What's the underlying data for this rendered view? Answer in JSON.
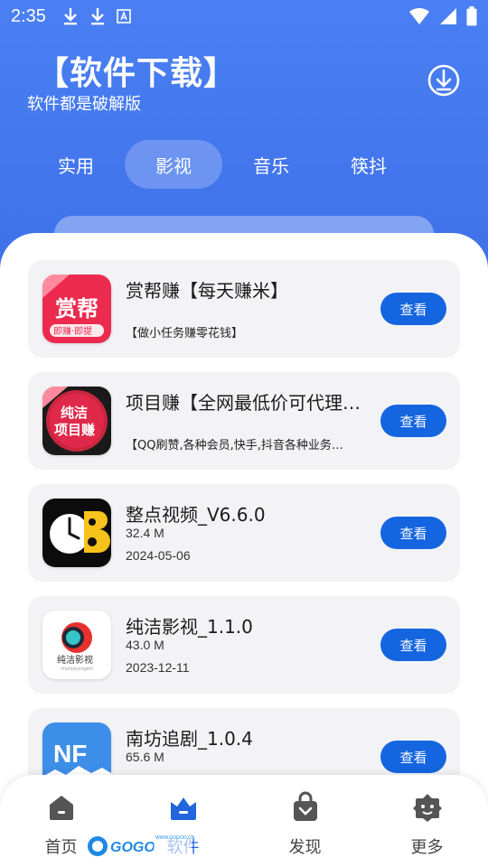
{
  "status_bar": {
    "time": "2:35",
    "left_icons": [
      "download-icon",
      "download-icon",
      "keyboard-a-icon"
    ],
    "right_icons": [
      "wifi-icon",
      "signal-icon",
      "battery-icon"
    ]
  },
  "header": {
    "title": "【软件下载】",
    "subtitle": "软件都是破解版",
    "download_icon": "download-circle-icon"
  },
  "tabs": [
    {
      "label": "实用",
      "active": false
    },
    {
      "label": "影视",
      "active": true
    },
    {
      "label": "音乐",
      "active": false
    },
    {
      "label": "筷抖",
      "active": false
    }
  ],
  "apps": [
    {
      "title": "赏帮赚【每天赚米】",
      "desc": "【做小任务赚零花钱】",
      "button": "查看",
      "icon": "shangbangzhuan-app-icon"
    },
    {
      "title": "项目赚【全网最低价可代理…",
      "desc": "【QQ刷赞,各种会员,快手,抖音各种业务…",
      "button": "查看",
      "icon": "xiangmuzhuan-app-icon"
    },
    {
      "title": "整点视频_V6.6.0",
      "size": "32.4 M",
      "date": "2024-05-06",
      "button": "查看",
      "icon": "zhengdian-video-app-icon"
    },
    {
      "title": "纯洁影视_1.1.0",
      "size": "43.0 M",
      "date": "2023-12-11",
      "button": "查看",
      "icon": "chunjie-video-app-icon"
    },
    {
      "title": "南坊追剧_1.0.4",
      "size": "65.6 M",
      "date": "",
      "button": "查看",
      "icon": "nanfang-app-icon"
    }
  ],
  "bottom_nav": [
    {
      "label": "首页",
      "icon": "home-icon",
      "active": false
    },
    {
      "label": "软件",
      "icon": "software-icon",
      "active": true
    },
    {
      "label": "发现",
      "icon": "bag-icon",
      "active": false
    },
    {
      "label": "更多",
      "icon": "more-icon",
      "active": false
    }
  ],
  "colors": {
    "header_blue": "#3f74ee",
    "button_blue": "#1565e0",
    "card_bg": "#f3f3f5",
    "nav_active": "#2266dd"
  }
}
